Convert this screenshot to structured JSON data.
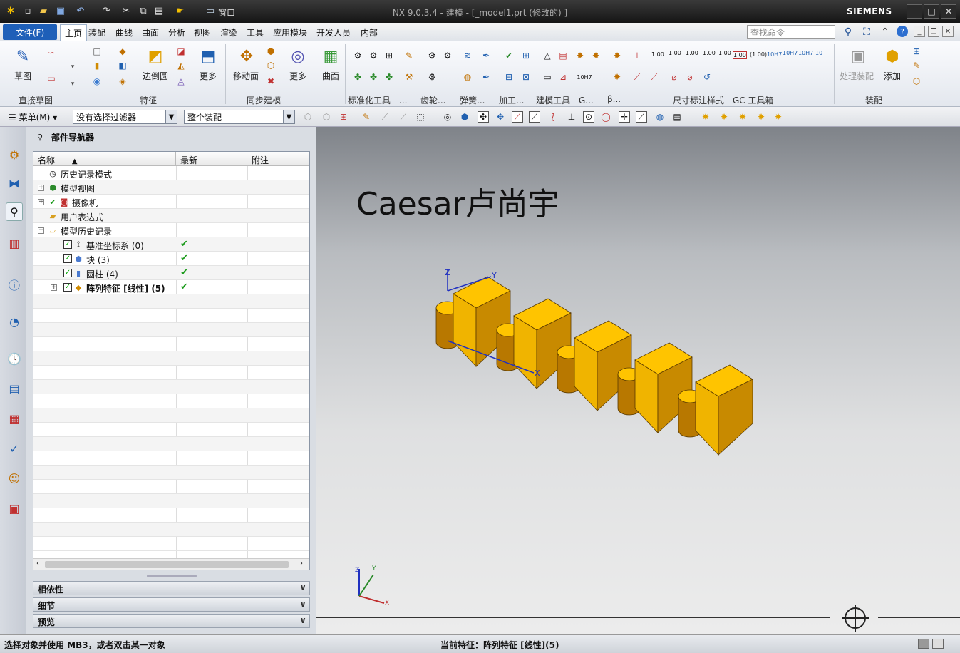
{
  "titlebar": {
    "title": "NX 9.0.3.4 - 建模 - [_model1.prt  (修改的) ]",
    "brand": "SIEMENS",
    "window_menu": "窗口"
  },
  "menubar": {
    "file": "文件(F)",
    "tabs": [
      "主页",
      "装配",
      "曲线",
      "曲面",
      "分析",
      "视图",
      "渲染",
      "工具",
      "应用模块",
      "开发人员",
      "内部"
    ],
    "active_tab": "主页",
    "search_placeholder": "查找命令"
  },
  "ribbon": {
    "sketch": "草图",
    "edge_blend": "边倒圆",
    "more1": "更多",
    "move_face": "移动面",
    "more2": "更多",
    "surface": "曲面",
    "process_assembly": "处理装配",
    "add": "添加",
    "groups": {
      "direct_sketch": "直接草图",
      "feature": "特征",
      "sync_modeling": "同步建模",
      "std_tools": "标准化工具 - ...",
      "gear": "齿轮...",
      "spring": "弹簧...",
      "machining": "加工...",
      "build_tools": "建模工具 - G...",
      "beta": "β...",
      "dimension_style": "尺寸标注样式 - GC 工具箱",
      "assembly": "装配"
    },
    "dim_labels": [
      "1.00",
      "1.00",
      "1.00",
      "1.00",
      "1.00",
      "(1.00)",
      "10H7"
    ]
  },
  "selection_bar": {
    "menu": "菜单(M)",
    "filter": "没有选择过滤器",
    "scope": "整个装配"
  },
  "navigator": {
    "title": "部件导航器",
    "columns": [
      "名称",
      "最新",
      "附注"
    ],
    "nodes": [
      {
        "label": "历史记录模式",
        "latest": ""
      },
      {
        "label": "模型视图",
        "latest": ""
      },
      {
        "label": "摄像机",
        "latest": ""
      },
      {
        "label": "用户表达式",
        "latest": ""
      },
      {
        "label": "模型历史记录",
        "latest": ""
      },
      {
        "label": "基准坐标系 (0)",
        "latest": "✔"
      },
      {
        "label": "块 (3)",
        "latest": "✔"
      },
      {
        "label": "圆柱 (4)",
        "latest": "✔"
      },
      {
        "label": "阵列特征 [线性] (5)",
        "latest": "✔"
      }
    ],
    "panels": [
      "相依性",
      "细节",
      "预览"
    ]
  },
  "viewport": {
    "part_text": "Caesar卢尚宇",
    "axis_labels": {
      "x": "X",
      "y": "Y",
      "z": "Z"
    }
  },
  "statusbar": {
    "prompt": "选择对象并使用 MB3，或者双击某一对象",
    "current_feature": "当前特征：阵列特征 [线性](5)"
  },
  "colors": {
    "block_yellow": "#ffc400",
    "block_dark": "#c88a00",
    "accent_blue": "#1e5fb8"
  }
}
